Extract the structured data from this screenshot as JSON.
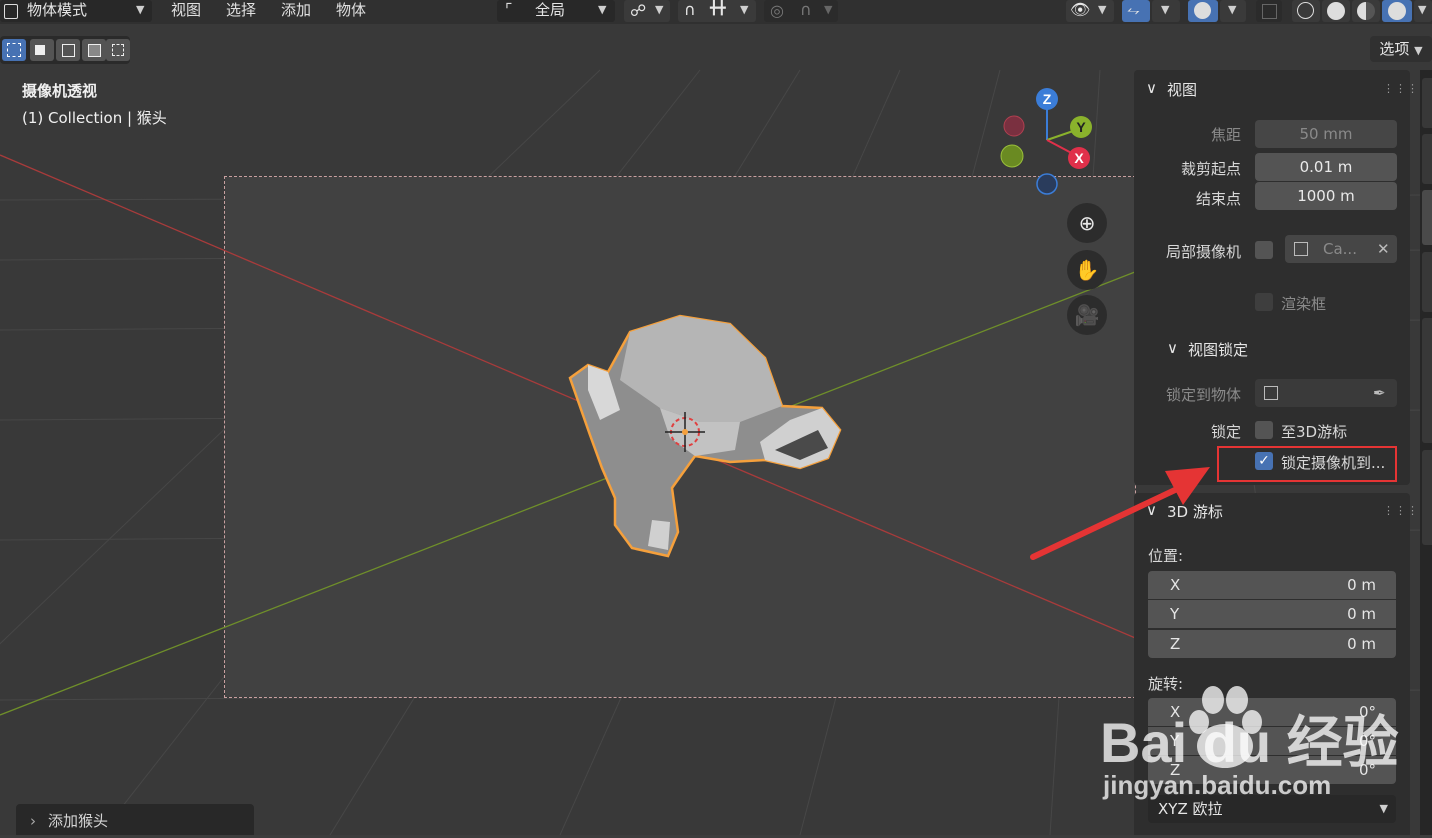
{
  "header": {
    "mode": "物体模式",
    "menus": [
      "视图",
      "选择",
      "添加",
      "物体"
    ],
    "transform_orientation": "全局"
  },
  "toolbar": {
    "options_label": "选项"
  },
  "viewport": {
    "view_name": "摄像机透视",
    "collection_info": "(1) Collection | 猴头",
    "gizmo": {
      "z": "Z",
      "y": "Y",
      "x": "X"
    },
    "last_operator": "添加猴头"
  },
  "view_panel": {
    "title": "视图",
    "focal_label": "焦距",
    "focal_value": "50 mm",
    "clip_start_label": "裁剪起点",
    "clip_start_value": "0.01 m",
    "clip_end_label": "结束点",
    "clip_end_value": "1000 m",
    "local_camera_label": "局部摄像机",
    "local_camera_value": "Ca...",
    "render_region_label": "渲染框",
    "view_lock_title": "视图锁定",
    "lock_to_object_label": "锁定到物体",
    "lock_label": "锁定",
    "lock_to_cursor_label": "至3D游标",
    "lock_camera_label": "锁定摄像机到..."
  },
  "cursor_panel": {
    "title": "3D 游标",
    "location_label": "位置:",
    "location": [
      {
        "axis": "X",
        "value": "0 m"
      },
      {
        "axis": "Y",
        "value": "0 m"
      },
      {
        "axis": "Z",
        "value": "0 m"
      }
    ],
    "rotation_label": "旋转:",
    "rotation": [
      {
        "axis": "X",
        "value": "0°"
      },
      {
        "axis": "Y",
        "value": "0°"
      },
      {
        "axis": "Z",
        "value": "0°"
      }
    ],
    "rotation_mode": "XYZ 欧拉"
  },
  "watermark": {
    "text": "Bai du 经验",
    "url": "jingyan.baidu.com"
  },
  "colors": {
    "accent": "#4772b3",
    "highlight": "#e53434",
    "selection": "#f5a03c"
  }
}
